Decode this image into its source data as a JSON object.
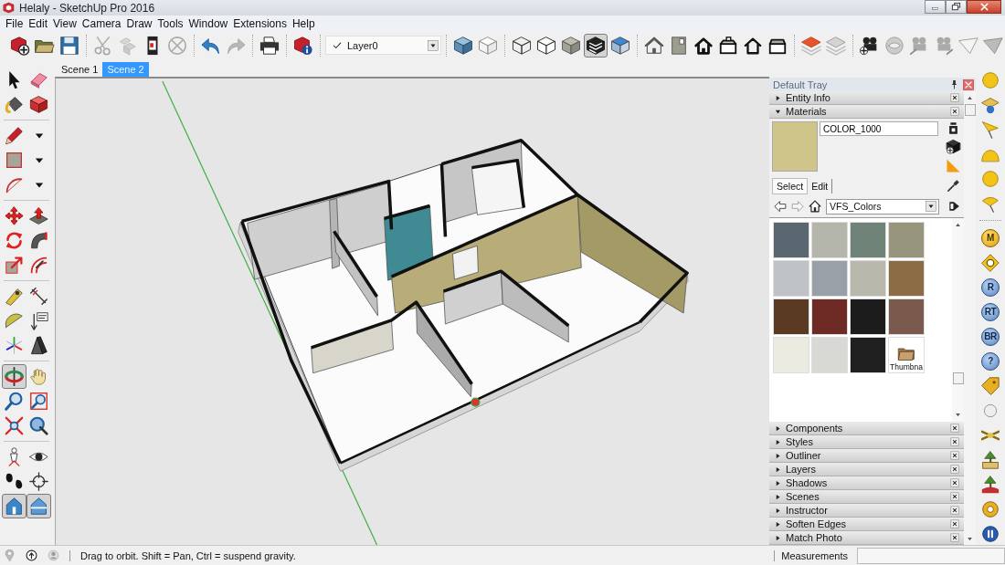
{
  "window": {
    "title": "Helaly - SketchUp Pro 2016"
  },
  "menu": [
    "File",
    "Edit",
    "View",
    "Camera",
    "Draw",
    "Tools",
    "Window",
    "Extensions",
    "Help"
  ],
  "toolbar": [
    {
      "kind": "buttons",
      "buttons": [
        {
          "selected": false,
          "disabled": false
        },
        {
          "selected": false,
          "disabled": false
        },
        {
          "selected": false,
          "disabled": false
        }
      ]
    },
    {
      "kind": "buttons",
      "buttons": [
        {
          "selected": false,
          "disabled": true
        },
        {
          "selected": false,
          "disabled": true
        },
        {
          "selected": false,
          "disabled": false
        },
        {
          "selected": false,
          "disabled": true
        }
      ]
    },
    {
      "kind": "buttons",
      "buttons": [
        {
          "selected": false,
          "disabled": false
        },
        {
          "selected": false,
          "disabled": true
        }
      ]
    },
    {
      "kind": "buttons",
      "buttons": [
        {
          "selected": false,
          "disabled": false
        }
      ]
    },
    {
      "kind": "buttons",
      "buttons": [
        {
          "selected": false,
          "disabled": false
        }
      ]
    },
    {
      "kind": "layer-select",
      "value": "Layer0"
    },
    {
      "kind": "buttons",
      "buttons": [
        {
          "selected": false,
          "disabled": false
        },
        {
          "selected": false,
          "disabled": false
        }
      ]
    },
    {
      "kind": "buttons",
      "buttons": [
        {
          "selected": false,
          "disabled": false
        },
        {
          "selected": false,
          "disabled": false
        },
        {
          "selected": false,
          "disabled": false
        },
        {
          "selected": true,
          "disabled": false
        },
        {
          "selected": false,
          "disabled": false
        }
      ]
    },
    {
      "kind": "buttons",
      "buttons": [
        {
          "selected": false,
          "disabled": false
        },
        {
          "selected": false,
          "disabled": false
        },
        {
          "selected": false,
          "disabled": false
        },
        {
          "selected": false,
          "disabled": false
        },
        {
          "selected": false,
          "disabled": false
        },
        {
          "selected": false,
          "disabled": false
        }
      ]
    },
    {
      "kind": "buttons",
      "buttons": [
        {
          "selected": false,
          "disabled": false
        },
        {
          "selected": false,
          "disabled": false
        }
      ]
    },
    {
      "kind": "buttons",
      "buttons": [
        {
          "selected": false,
          "disabled": false
        },
        {
          "selected": false,
          "disabled": false
        },
        {
          "selected": false,
          "disabled": false
        },
        {
          "selected": false,
          "disabled": false
        },
        {
          "selected": false,
          "disabled": false
        },
        {
          "selected": false,
          "disabled": false
        }
      ]
    }
  ],
  "scenes": [
    {
      "label": "Scene 1",
      "selected": false
    },
    {
      "label": "Scene 2",
      "selected": true
    }
  ],
  "left_toolbar": [
    {
      "tools": [
        {
          "kind": "tool",
          "selected": false
        },
        {
          "kind": "tool",
          "selected": false
        },
        {
          "kind": "tool",
          "selected": false
        },
        {
          "kind": "tool",
          "selected": false
        }
      ]
    },
    {
      "tools": [
        {
          "kind": "tool",
          "selected": false
        },
        {
          "kind": "menu-arrow",
          "selected": false
        },
        {
          "kind": "tool",
          "selected": false
        },
        {
          "kind": "menu-arrow",
          "selected": false
        },
        {
          "kind": "tool",
          "selected": false
        },
        {
          "kind": "menu-arrow",
          "selected": false
        }
      ]
    },
    {
      "tools": [
        {
          "kind": "tool",
          "selected": false
        },
        {
          "kind": "tool",
          "selected": false
        },
        {
          "kind": "tool",
          "selected": false
        },
        {
          "kind": "tool",
          "selected": false
        },
        {
          "kind": "tool",
          "selected": false
        },
        {
          "kind": "tool",
          "selected": false
        }
      ]
    },
    {
      "tools": [
        {
          "kind": "tool",
          "selected": false
        },
        {
          "kind": "tool",
          "selected": false
        },
        {
          "kind": "tool",
          "selected": false
        },
        {
          "kind": "tool",
          "selected": false
        },
        {
          "kind": "tool",
          "selected": false
        },
        {
          "kind": "tool",
          "selected": false
        }
      ]
    },
    {
      "tools": [
        {
          "kind": "tool",
          "selected": true
        },
        {
          "kind": "tool",
          "selected": false
        },
        {
          "kind": "tool",
          "selected": false
        },
        {
          "kind": "tool",
          "selected": false
        },
        {
          "kind": "tool",
          "selected": false
        },
        {
          "kind": "tool",
          "selected": false
        }
      ]
    },
    {
      "tools": [
        {
          "kind": "tool",
          "selected": false
        },
        {
          "kind": "tool",
          "selected": false
        },
        {
          "kind": "tool",
          "selected": false
        },
        {
          "kind": "tool",
          "selected": false
        },
        {
          "kind": "tool",
          "selected": true
        },
        {
          "kind": "tool",
          "selected": true
        }
      ]
    }
  ],
  "tray": {
    "title": "Default Tray",
    "panels": [
      {
        "title": "Entity Info",
        "expanded": false
      },
      {
        "title": "Materials",
        "expanded": true,
        "materials": {
          "color": "#cfc48a",
          "name": "COLOR_1000",
          "tabs": [
            {
              "label": "Select",
              "selected": true
            },
            {
              "label": "Edit",
              "selected": false
            }
          ],
          "nav": [
            {
              "disabled": false
            },
            {
              "disabled": true
            },
            {
              "disabled": false
            }
          ],
          "library": "VFS_Colors",
          "swatches": [
            {
              "kind": "color",
              "color": "#5a6670"
            },
            {
              "kind": "color",
              "color": "#b4b5ab"
            },
            {
              "kind": "color",
              "color": "#6f8379"
            },
            {
              "kind": "color",
              "color": "#97957c"
            },
            {
              "kind": "color",
              "color": "#bfc3c7"
            },
            {
              "kind": "color",
              "color": "#9aa0a8"
            },
            {
              "kind": "color",
              "color": "#b8b8ac"
            },
            {
              "kind": "color",
              "color": "#8c6c44"
            },
            {
              "kind": "color",
              "color": "#5a3a22"
            },
            {
              "kind": "color",
              "color": "#6e2a24"
            },
            {
              "kind": "color",
              "color": "#1c1c1c"
            },
            {
              "kind": "color",
              "color": "#7a5a4c"
            },
            {
              "kind": "color",
              "color": "#ecebe2"
            },
            {
              "kind": "color",
              "color": "#d8d8d4"
            },
            {
              "kind": "color",
              "color": "#202020"
            },
            {
              "kind": "folder",
              "label": "Thumbna"
            }
          ]
        }
      },
      {
        "title": "Components",
        "expanded": false
      },
      {
        "title": "Styles",
        "expanded": false
      },
      {
        "title": "Outliner",
        "expanded": false
      },
      {
        "title": "Layers",
        "expanded": false
      },
      {
        "title": "Shadows",
        "expanded": false
      },
      {
        "title": "Scenes",
        "expanded": false
      },
      {
        "title": "Instructor",
        "expanded": false
      },
      {
        "title": "Soften Edges",
        "expanded": false
      },
      {
        "title": "Match Photo",
        "expanded": false
      }
    ]
  },
  "side_toolbar": [
    {
      "items": [
        {
          "kind": "icon"
        },
        {
          "kind": "icon"
        },
        {
          "kind": "icon"
        },
        {
          "kind": "icon"
        },
        {
          "kind": "icon"
        },
        {
          "kind": "icon"
        }
      ]
    },
    {
      "items": [
        {
          "kind": "letter",
          "label": "M"
        },
        {
          "kind": "icon"
        },
        {
          "kind": "letter",
          "label": "R"
        },
        {
          "kind": "letter",
          "label": "RT"
        },
        {
          "kind": "letter",
          "label": "BR"
        },
        {
          "kind": "letter",
          "label": "?"
        },
        {
          "kind": "icon"
        },
        {
          "kind": "icon"
        },
        {
          "kind": "icon"
        },
        {
          "kind": "icon"
        },
        {
          "kind": "icon"
        },
        {
          "kind": "icon"
        },
        {
          "kind": "icon"
        }
      ]
    }
  ],
  "status_bar": {
    "hint": "Drag to orbit. Shift = Pan, Ctrl = suspend gravity.",
    "measurements_label": "Measurements"
  }
}
